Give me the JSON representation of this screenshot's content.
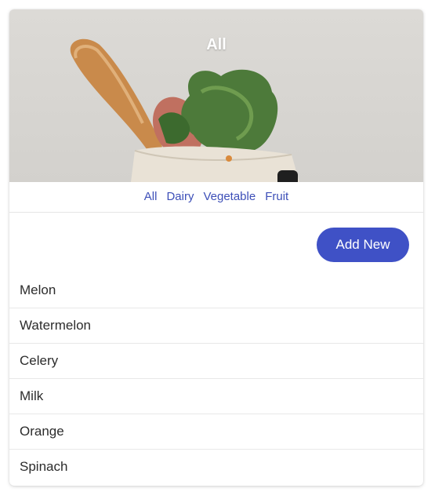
{
  "hero": {
    "title": "All"
  },
  "tabs": [
    "All",
    "Dairy",
    "Vegetable",
    "Fruit"
  ],
  "actions": {
    "add_label": "Add New"
  },
  "items": [
    "Melon",
    "Watermelon",
    "Celery",
    "Milk",
    "Orange",
    "Spinach"
  ],
  "colors": {
    "accent": "#3f51c6",
    "link": "#3d4fb8",
    "text": "#2c2c2c"
  }
}
